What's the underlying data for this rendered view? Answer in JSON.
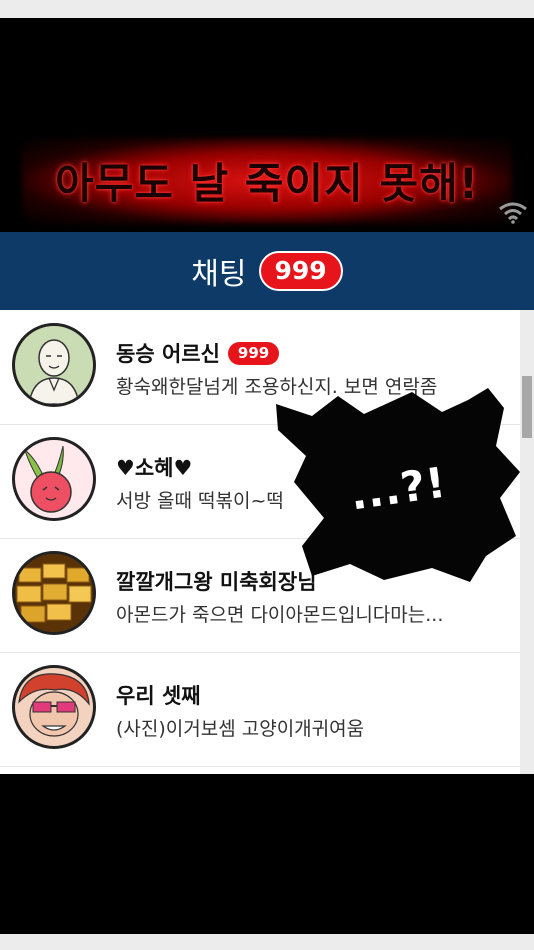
{
  "banner": {
    "title": "아무도 날 죽이지 못해!"
  },
  "header": {
    "title": "채팅",
    "badge": "999"
  },
  "chats": [
    {
      "name": "동승 어르신",
      "badge": "999",
      "message": "황숙왜한달넘게 조용하신지. 보면 연락좀"
    },
    {
      "name": "♥소혜♥",
      "badge": "",
      "message": "서방 올때 떡볶이~떡"
    },
    {
      "name": "깔깔개그왕 미축회장님",
      "badge": "",
      "message": "아몬드가 죽으면 다이아몬드입니다마는..."
    },
    {
      "name": "우리 셋째",
      "badge": "",
      "message": "(사진)이거보셈 고양이개귀여움"
    }
  ],
  "overlay": {
    "text": "...?!"
  },
  "colors": {
    "header_bg": "#0d3a66",
    "badge_red": "#e8141b",
    "banner_glow": "#d81414"
  },
  "icons": {
    "status": "wifi-icon"
  }
}
